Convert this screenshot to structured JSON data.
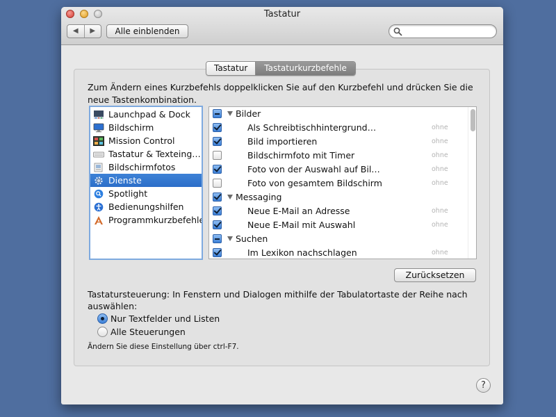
{
  "window": {
    "title": "Tastatur",
    "nav_back": "◀",
    "nav_forward": "▶",
    "show_all_label": "Alle einblenden",
    "search": {
      "value": "",
      "placeholder": ""
    }
  },
  "tabs": [
    {
      "label": "Tastatur",
      "selected": false
    },
    {
      "label": "Tastaturkurzbefehle",
      "selected": true
    }
  ],
  "instructions": "Zum Ändern eines Kurzbefehls doppelklicken Sie auf den Kurzbefehl und drücken Sie die neue Tastenkombination.",
  "categories": [
    {
      "label": "Launchpad & Dock",
      "icon": "launchpad-dock-icon"
    },
    {
      "label": "Bildschirm",
      "icon": "display-icon"
    },
    {
      "label": "Mission Control",
      "icon": "mission-control-icon"
    },
    {
      "label": "Tastatur & Texteing…",
      "icon": "keyboard-icon"
    },
    {
      "label": "Bildschirmfotos",
      "icon": "screenshot-icon"
    },
    {
      "label": "Dienste",
      "icon": "gear-icon",
      "selected": true
    },
    {
      "label": "Spotlight",
      "icon": "spotlight-icon"
    },
    {
      "label": "Bedienungshilfen",
      "icon": "accessibility-icon"
    },
    {
      "label": "Programmkurzbefehle",
      "icon": "app-shortcuts-icon"
    }
  ],
  "shortcuts": [
    {
      "type": "group",
      "label": "Bilder",
      "state": "mixed"
    },
    {
      "type": "item",
      "label": "Als Schreibtischhintergrund…",
      "checked": true,
      "shortcut": "ohne"
    },
    {
      "type": "item",
      "label": "Bild importieren",
      "checked": true,
      "shortcut": "ohne"
    },
    {
      "type": "item",
      "label": "Bildschirmfoto mit Timer",
      "checked": false,
      "shortcut": "ohne"
    },
    {
      "type": "item",
      "label": "Foto von der Auswahl auf Bil…",
      "checked": true,
      "shortcut": "ohne"
    },
    {
      "type": "item",
      "label": "Foto von gesamtem Bildschirm",
      "checked": false,
      "shortcut": "ohne"
    },
    {
      "type": "group",
      "label": "Messaging",
      "state": "checked"
    },
    {
      "type": "item",
      "label": "Neue E-Mail an Adresse",
      "checked": true,
      "shortcut": "ohne"
    },
    {
      "type": "item",
      "label": "Neue E-Mail mit Auswahl",
      "checked": true,
      "shortcut": "ohne"
    },
    {
      "type": "group",
      "label": "Suchen",
      "state": "mixed"
    },
    {
      "type": "item",
      "label": "Im Lexikon nachschlagen",
      "checked": true,
      "shortcut": "ohne"
    }
  ],
  "reset_label": "Zurücksetzen",
  "keyboard_control": {
    "text": "Tastatursteuerung: In Fenstern und Dialogen mithilfe der Tabulatortaste der Reihe nach auswählen:",
    "options": [
      {
        "label": "Nur Textfelder und Listen",
        "selected": true
      },
      {
        "label": "Alle Steuerungen",
        "selected": false
      }
    ],
    "hint": "Ändern Sie diese Einstellung über ctrl-F7."
  },
  "help_label": "?"
}
